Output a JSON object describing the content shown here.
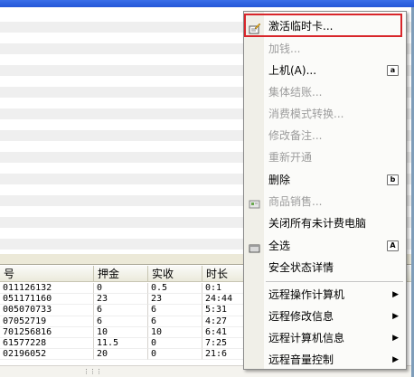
{
  "grid": {
    "columns": [
      "号",
      "押金",
      "实收",
      "时长"
    ],
    "rows": [
      [
        "011126132",
        "0",
        "0.5",
        "0:1"
      ],
      [
        "051171160",
        "23",
        "23",
        "24:44"
      ],
      [
        "005070733",
        "6",
        "6",
        "5:31"
      ],
      [
        "07052719",
        "6",
        "6",
        "4:27"
      ],
      [
        "701256816",
        "10",
        "10",
        "6:41"
      ],
      [
        "61577228",
        "11.5",
        "0",
        "7:25"
      ],
      [
        "02196052",
        "20",
        "0",
        "21:6"
      ]
    ]
  },
  "menu": {
    "items": [
      {
        "label": "激活临时卡...",
        "disabled": false,
        "icon": "card-edit-icon"
      },
      {
        "label": "加钱...",
        "disabled": true
      },
      {
        "label": "上机(A)...",
        "disabled": false,
        "shortcut": "a"
      },
      {
        "label": "集体结账...",
        "disabled": true
      },
      {
        "label": "消费模式转换...",
        "disabled": true
      },
      {
        "label": "修改备注...",
        "disabled": true
      },
      {
        "label": "重新开通",
        "disabled": true
      },
      {
        "label": "删除",
        "disabled": false,
        "shortcut": "b"
      },
      {
        "label": "商品销售...",
        "disabled": true,
        "icon": "goods-icon"
      },
      {
        "label": "关闭所有未计费电脑",
        "disabled": false
      },
      {
        "label": "全选",
        "disabled": false,
        "icon": "select-all-icon",
        "shortcut": "A"
      },
      {
        "label": "安全状态详情",
        "disabled": false
      },
      {
        "label": "远程操作计算机",
        "disabled": false,
        "submenu": true
      },
      {
        "label": "远程修改信息",
        "disabled": false,
        "submenu": true
      },
      {
        "label": "远程计算机信息",
        "disabled": false,
        "submenu": true
      },
      {
        "label": "远程音量控制",
        "disabled": false,
        "submenu": true
      }
    ],
    "submenu_arrow": "▶",
    "scroll_thumb": "⋮⋮⋮"
  },
  "colors": {
    "highlight_border": "#d8262b",
    "disabled_text": "#9d9d9d",
    "titlebar": "#2c62e0"
  }
}
